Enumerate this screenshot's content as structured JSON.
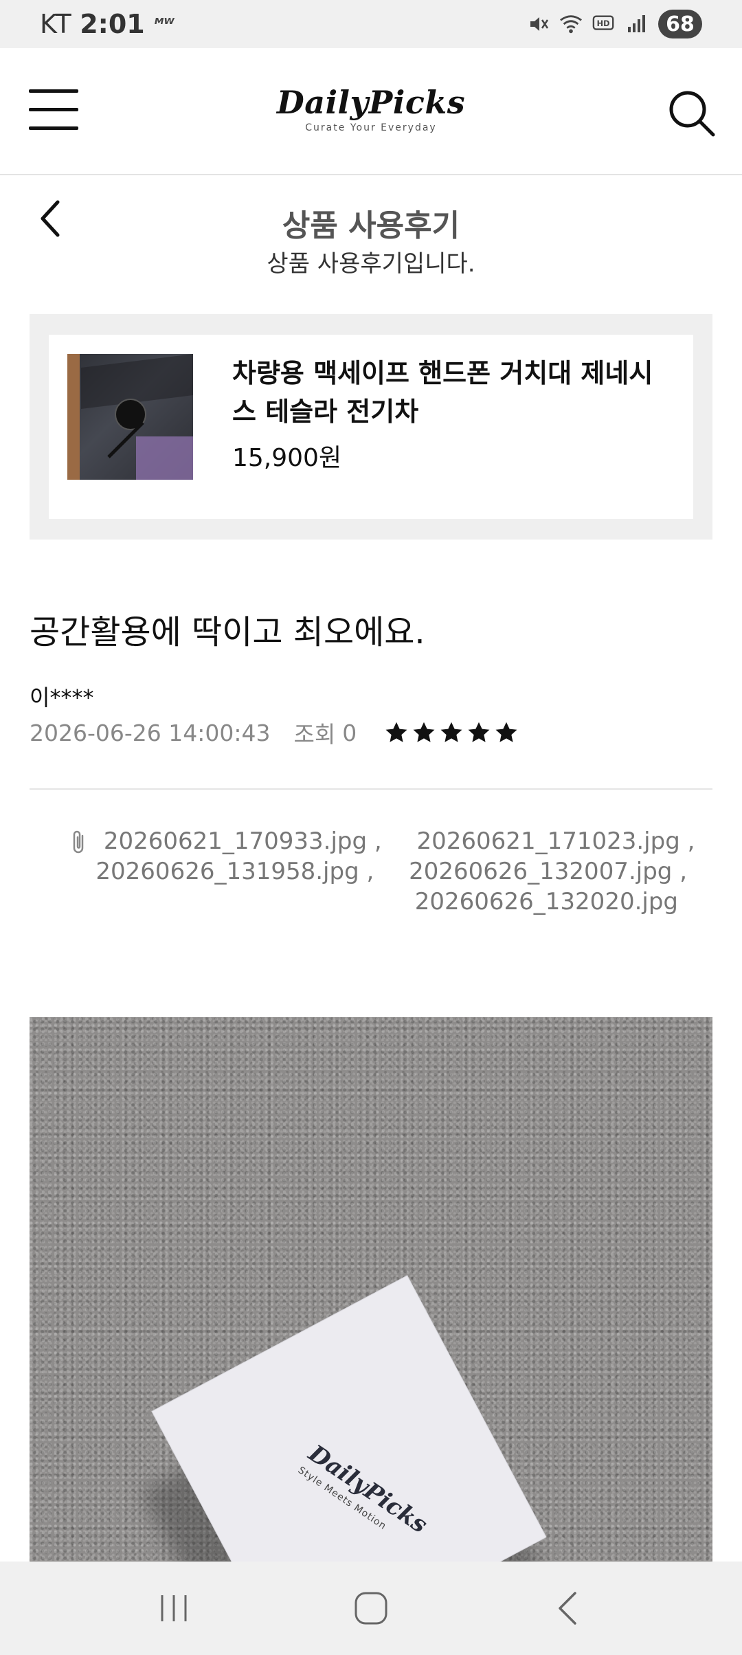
{
  "status_bar": {
    "carrier": "KT",
    "time": "2:01",
    "extra_icon": "ᴹᵂ",
    "battery": "68"
  },
  "header": {
    "logo": "DailyPicks",
    "tagline": "Curate Your Everyday"
  },
  "page": {
    "title": "상품 사용후기",
    "subtitle": "상품 사용후기입니다."
  },
  "product": {
    "name": "차량용 맥세이프 핸드폰 거치대 제네시스 테슬라 전기차",
    "price": "15,900원"
  },
  "review": {
    "title": "공간활용에 딱이고 최오에요.",
    "author": "이****",
    "date": "2026-06-26 14:00:43",
    "views_label": "조회",
    "views_count": "0",
    "rating": 5
  },
  "attachments": {
    "files": [
      "20260621_170933.jpg",
      "20260621_171023.jpg",
      "20260626_131958.jpg",
      "20260626_132007.jpg",
      "20260626_132020.jpg"
    ],
    "separator": ","
  },
  "photo": {
    "box_brand": "DailyPicks",
    "box_tagline": "Style Meets Motion"
  },
  "colors": {
    "background": "#ffffff",
    "status_bar": "#f0f0f0",
    "card_bg": "#efefef",
    "star": "#111111",
    "muted_text": "#888888"
  }
}
